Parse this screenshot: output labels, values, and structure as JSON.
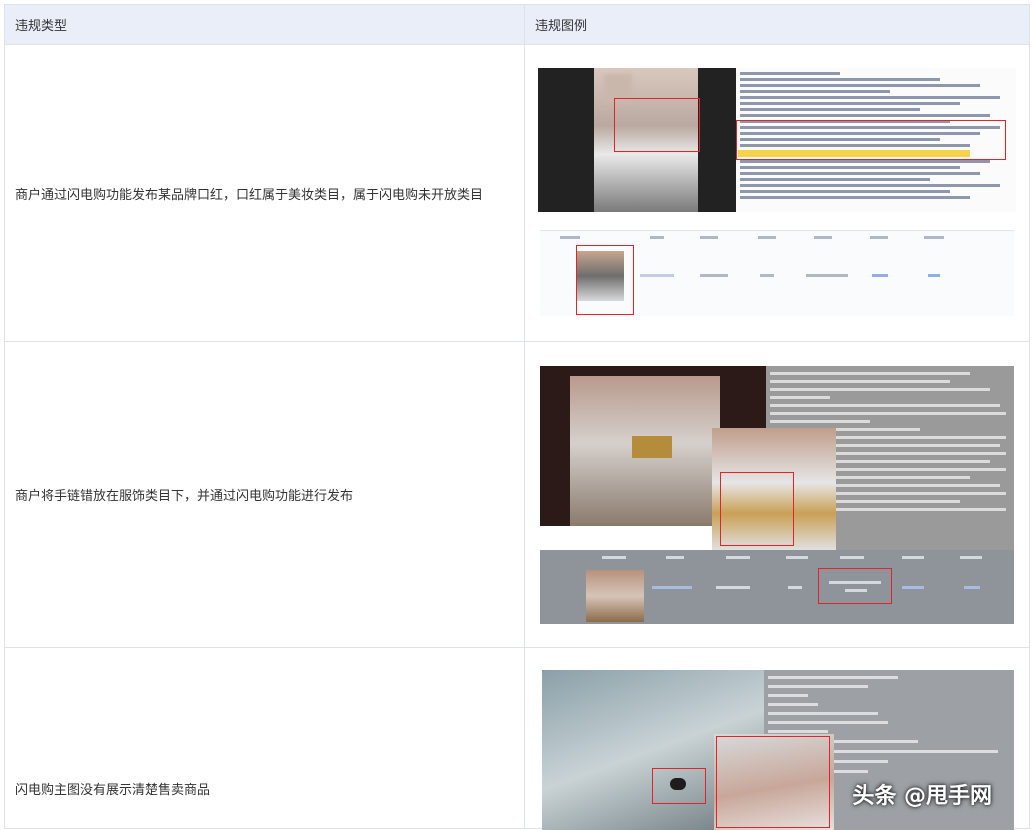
{
  "table": {
    "headers": {
      "type": "违规类型",
      "example": "违规图例"
    },
    "rows": [
      {
        "type": "商户通过闪电购功能发布某品牌口红，口红属于美妆类目，属于闪电购未开放类目"
      },
      {
        "type": "商户将手链错放在服饰类目下，并通过闪电购功能进行发布"
      },
      {
        "type": "闪电购主图没有展示清楚售卖商品"
      }
    ]
  },
  "watermark": "头条 @甩手网",
  "colors": {
    "header_bg": "#e9eef8",
    "border": "#dfe3e8",
    "highlight_red": "#e0242a"
  }
}
